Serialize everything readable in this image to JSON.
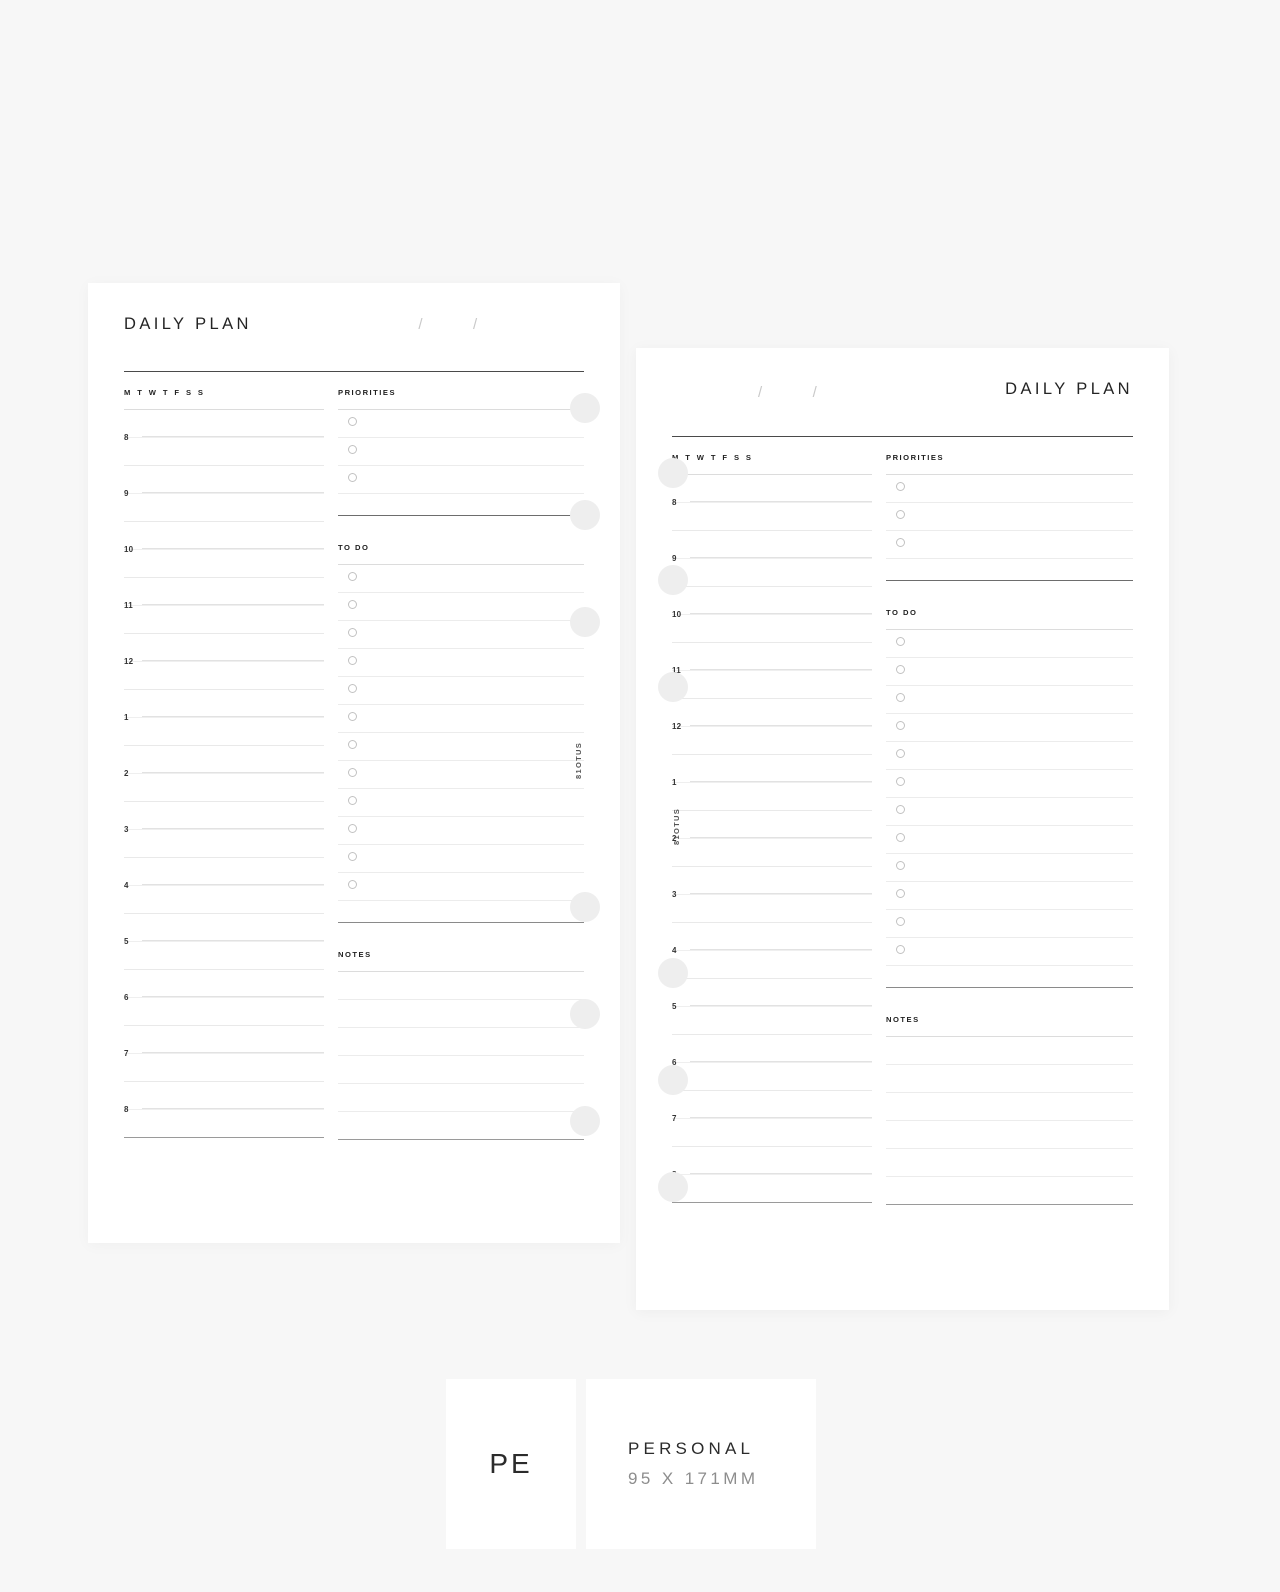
{
  "background_color": "#f7f7f7",
  "pages": [
    {
      "id": "left",
      "title": "DAILY PLAN",
      "title_align": "left",
      "date_slash_1": "/",
      "date_slash_2": "/",
      "weekday_strip": "M T W T F S S",
      "priorities_label": "PRIORITIES",
      "todo_label": "TO DO",
      "notes_label": "NOTES",
      "brand": "81OTUS",
      "hours": [
        "8",
        "9",
        "10",
        "11",
        "12",
        "1",
        "2",
        "3",
        "4",
        "5",
        "6",
        "7",
        "8"
      ],
      "priorities_count": 3,
      "todo_count": 12,
      "notes_count": 6,
      "hole_count": 6
    },
    {
      "id": "right",
      "title": "DAILY PLAN",
      "title_align": "right",
      "date_slash_1": "/",
      "date_slash_2": "/",
      "weekday_strip": "M T W T F S S",
      "priorities_label": "PRIORITIES",
      "todo_label": "TO DO",
      "notes_label": "NOTES",
      "brand": "81OTUS",
      "hours": [
        "8",
        "9",
        "10",
        "11",
        "12",
        "1",
        "2",
        "3",
        "4",
        "5",
        "6",
        "7",
        "8"
      ],
      "priorities_count": 3,
      "todo_count": 12,
      "notes_count": 6,
      "hole_count": 6
    }
  ],
  "footer": {
    "code": "PE",
    "size_name": "PERSONAL",
    "size_dimensions": "95 X 171MM"
  }
}
